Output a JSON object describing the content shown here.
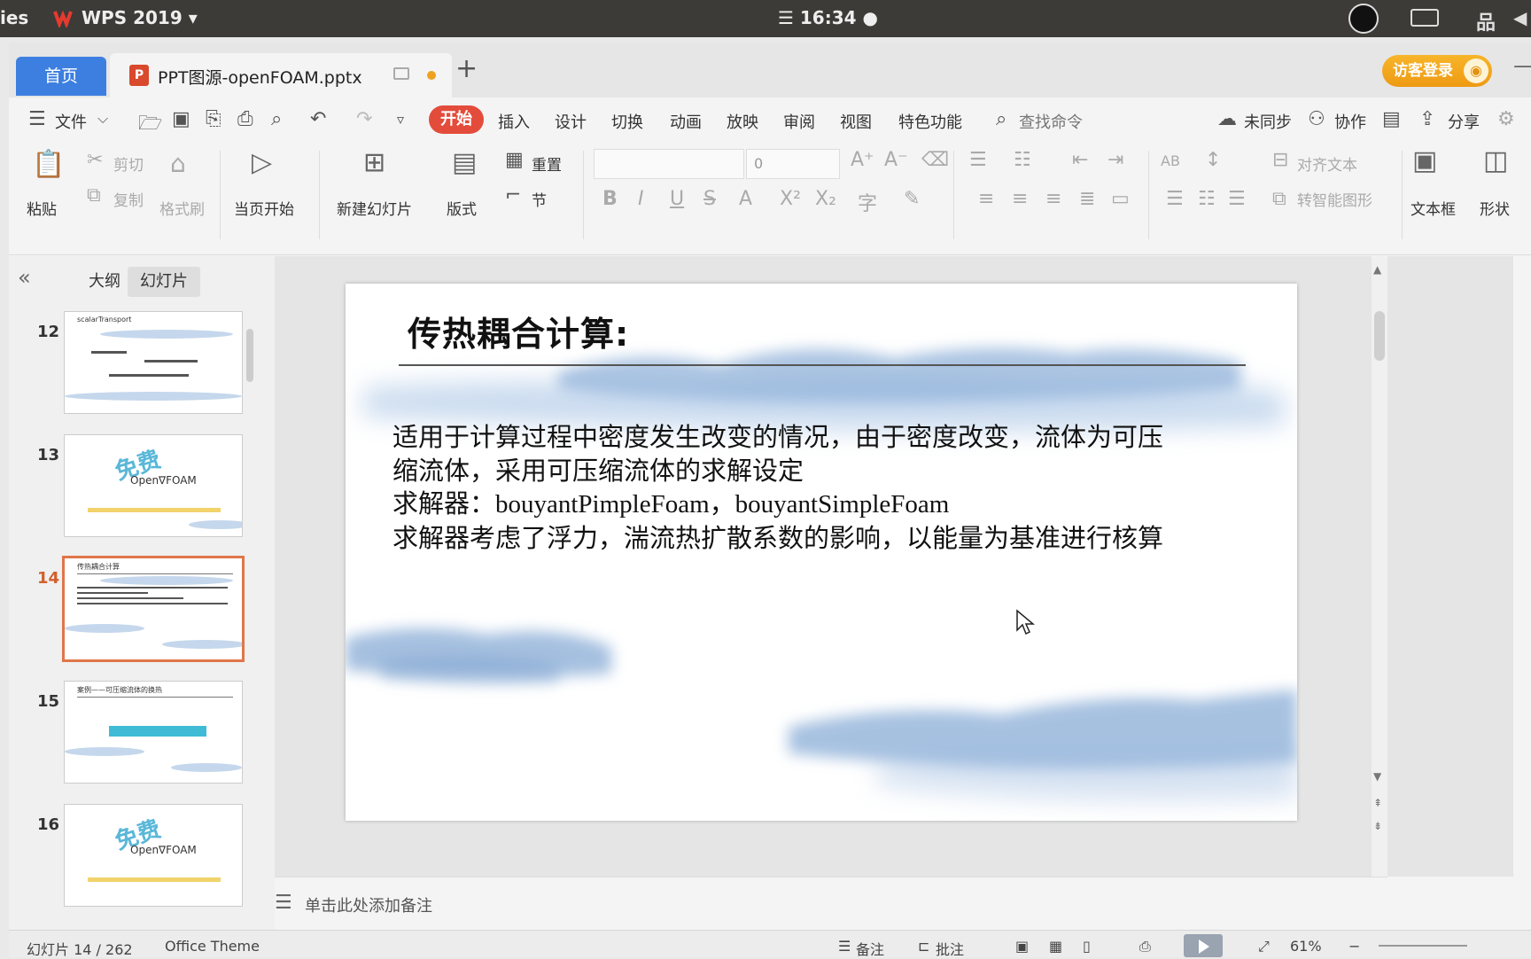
{
  "os_bar": {
    "left_text": "ies",
    "app_name": "WPS 2019 ▾",
    "clock": "☰ 16:34 ●"
  },
  "tabs": {
    "home": "首页",
    "document": "PPT图源-openFOAM.pptx",
    "doc_icon_letter": "P",
    "new_tab": "+",
    "login": "访客登录"
  },
  "menu": {
    "file": "文件",
    "items": [
      "开始",
      "插入",
      "设计",
      "切换",
      "动画",
      "放映",
      "审阅",
      "视图",
      "特色功能"
    ],
    "search_placeholder": "查找命令",
    "unsynced": "未同步",
    "collaborate": "协作",
    "share": "分享"
  },
  "ribbon": {
    "paste": "粘贴",
    "cut": "剪切",
    "copy": "复制",
    "format_painter": "格式刷",
    "from_current": "当页开始",
    "new_slide": "新建幻灯片",
    "layout": "版式",
    "reset": "重置",
    "section": "节",
    "font_size": "0",
    "align_text": "对齐文本",
    "smartart": "转智能图形",
    "textbox": "文本框",
    "shape": "形状"
  },
  "left_pane": {
    "tab_outline": "大纲",
    "tab_slides": "幻灯片",
    "thumbnails": [
      {
        "num": "12",
        "title": "scalarTransport"
      },
      {
        "num": "13",
        "badge": "免费",
        "brand": "Open∇FOAM"
      },
      {
        "num": "14",
        "title": "传热耦合计算"
      },
      {
        "num": "15",
        "title": "案例——可压缩流体的换热"
      },
      {
        "num": "16",
        "badge": "免费",
        "brand": "Open∇FOAM"
      }
    ],
    "selected": "14"
  },
  "slide": {
    "title": "传热耦合计算:",
    "body_lines": [
      "适用于计算过程中密度发生改变的情况，由于密度改变，流体为可压",
      "缩流体，采用可压缩流体的求解设定",
      "求解器：bouyantPimpleFoam，bouyantSimpleFoam",
      "求解器考虑了浮力，湍流热扩散系数的影响，以能量为基准进行核算"
    ]
  },
  "notes": {
    "placeholder": "单击此处添加备注"
  },
  "status": {
    "slide_count": "幻灯片 14 / 262",
    "theme": "Office Theme",
    "notes": "备注",
    "comments": "批注",
    "zoom": "61%"
  },
  "colors": {
    "accent_blue": "#3d7fe0",
    "start_red": "#e34c3b",
    "login_orange": "#f7b52a",
    "selected_thumb": "#e0764a"
  }
}
